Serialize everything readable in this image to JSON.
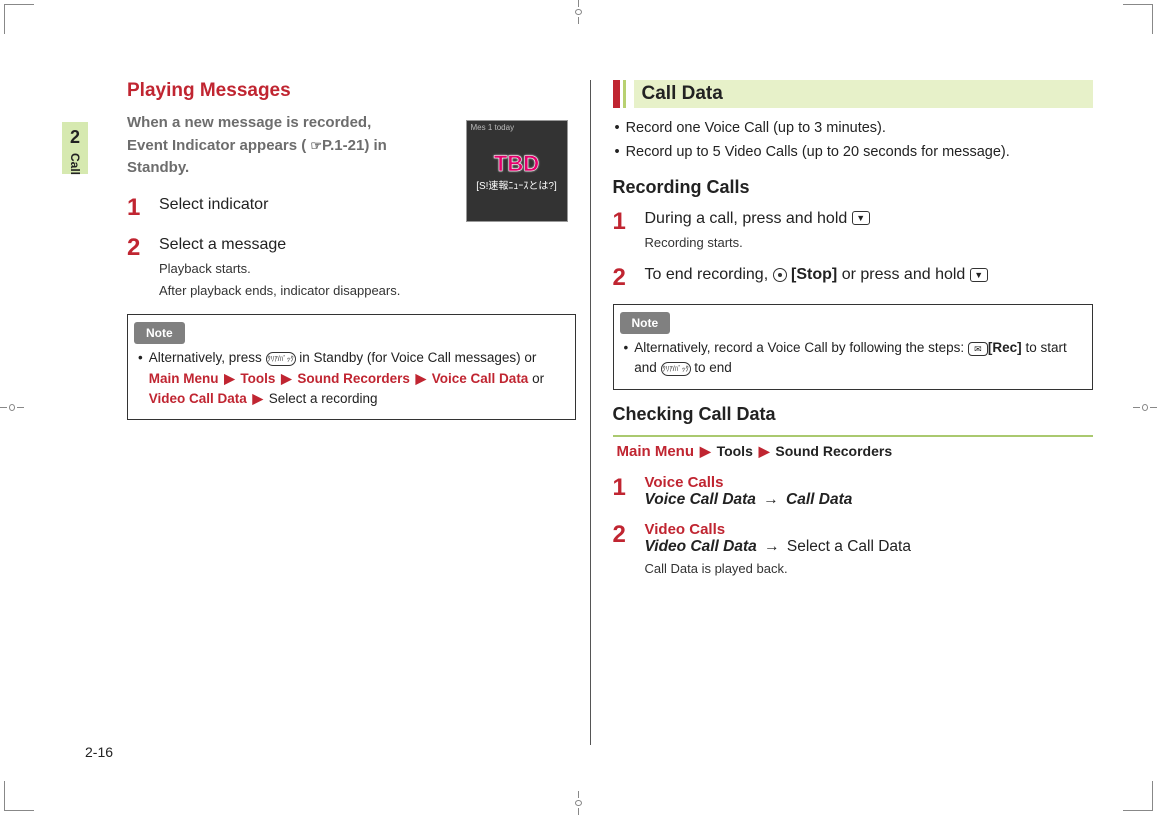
{
  "crop": {
    "circle": true
  },
  "side_tab": {
    "num": "2",
    "cap": "Call"
  },
  "left": {
    "heading": "Playing Messages",
    "leadin_l1": "When a new message is recorded,",
    "leadin_l2": "Event Indicator appears (",
    "leadin_ref": "P.1-21",
    "leadin_l3": ") in Standby.",
    "thumb": {
      "top_text": "Mes 1 today",
      "tbd": "TBD",
      "jp": "[S!速報ﾆｭｰｽとは?]"
    },
    "steps": [
      {
        "num": "1",
        "body": "Select indicator"
      },
      {
        "num": "2",
        "body": "Select a message",
        "sub1": "Playback starts.",
        "sub2": "After playback ends, indicator disappears."
      }
    ],
    "note_label": "Note",
    "note": {
      "line1_a": "Alternatively, press ",
      "clr": "ｸﾘｱ/ﾊﾞｯｸ",
      "line1_b": " in Standby (for Voice Call messages) or ",
      "menu": "Main Menu",
      "tools": "Tools",
      "sound": "Sound Recorders",
      "voice": "Voice Call Data",
      "or": " or ",
      "video": "Video Call Data",
      "tail": " Select a recording",
      "arrow": "▶"
    }
  },
  "right": {
    "section_title": "Call Data",
    "bullets": [
      "Record one Voice Call (up to 3 minutes).",
      "Record up to 5 Video Calls (up to 20 seconds for message)."
    ],
    "rec_heading": "Recording Calls",
    "rec_steps": [
      {
        "num": "1",
        "pre": "During a call, press and hold ",
        "key": "▼",
        "sub": "Recording starts."
      },
      {
        "num": "2",
        "pre": "To end recording, ",
        "stop": "[Stop]",
        "mid": " or press and hold ",
        "key": "▼"
      }
    ],
    "note_label": "Note",
    "note": {
      "line_a": "Alternatively, record a Voice Call by following the steps: ",
      "mail": "✉",
      "rec": "[Rec]",
      "to_start": " to start and ",
      "clr": "ｸﾘｱ/ﾊﾞｯｸ",
      "to_end": " to end"
    },
    "check_heading": "Checking Call Data",
    "nav": {
      "menu": "Main Menu",
      "tools": "Tools",
      "sound": "Sound Recorders",
      "arrow": "▶"
    },
    "check_steps": [
      {
        "num": "1",
        "label": "Voice Calls",
        "path_a": "Voice Call Data",
        "arrow": "→",
        "path_b": "Call Data"
      },
      {
        "num": "2",
        "label": "Video Calls",
        "path_a": "Video Call Data",
        "arrow": "→",
        "path_b": " Select a Call Data",
        "sub": "Call Data is played back."
      }
    ]
  },
  "page_foot": "2-16"
}
